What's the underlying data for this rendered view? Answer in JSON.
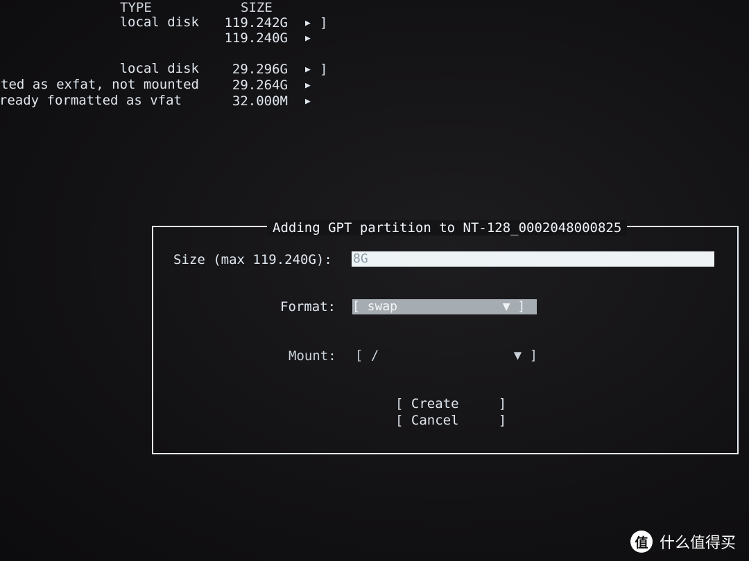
{
  "disk_list": {
    "headers": {
      "type": "TYPE",
      "size": "SIZE"
    },
    "rows": [
      {
        "type": "local disk",
        "size": "119.242G",
        "arrow": "▶",
        "bracket": "]"
      },
      {
        "type": "",
        "size": "119.240G",
        "arrow": "▶",
        "bracket": ""
      },
      {
        "type": "local disk",
        "size": "29.296G",
        "arrow": "▶",
        "bracket": "]"
      },
      {
        "type": "ted as exfat, not mounted",
        "size": "29.264G",
        "arrow": "▶",
        "bracket": ""
      },
      {
        "type": "ready formatted as vfat",
        "size": "32.000M",
        "arrow": "▶",
        "bracket": ""
      }
    ]
  },
  "dialog": {
    "title": "Adding GPT partition to NT-128_0002048000825",
    "size_label": "Size (max 119.240G):",
    "size_value": "8G",
    "format_label": "Format:",
    "format_value": "[ swap              ▼ ]",
    "mount_label": "Mount:",
    "mount_value": "[ /                 ▼ ]",
    "create_button": "[ Create     ]",
    "cancel_button": "[ Cancel     ]"
  },
  "watermark": {
    "logo": "值",
    "text": "什么值得买"
  }
}
